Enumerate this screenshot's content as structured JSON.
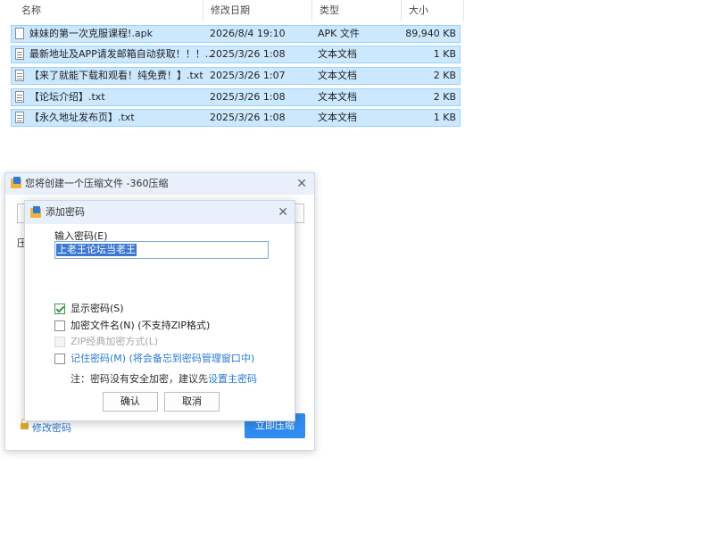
{
  "explorer": {
    "columns": {
      "name": "名称",
      "date": "修改日期",
      "type": "类型",
      "size": "大小"
    },
    "files": [
      {
        "name": "妹妹的第一次克服课程!.apk",
        "date": "2026/8/4 19:10",
        "type": "APK 文件",
        "size": "89,940 KB",
        "icon": "file-icon"
      },
      {
        "name": "最新地址及APP请发邮箱自动获取！！！....",
        "date": "2025/3/26 1:08",
        "type": "文本文档",
        "size": "1 KB",
        "icon": "text-file-icon"
      },
      {
        "name": "【来了就能下载和观看！纯免费！】.txt",
        "date": "2025/3/26 1:07",
        "type": "文本文档",
        "size": "2 KB",
        "icon": "text-file-icon"
      },
      {
        "name": "【论坛介绍】.txt",
        "date": "2025/3/26 1:08",
        "type": "文本文档",
        "size": "2 KB",
        "icon": "text-file-icon"
      },
      {
        "name": "【永久地址发布页】.txt",
        "date": "2025/3/26 1:08",
        "type": "文本文档",
        "size": "1 KB",
        "icon": "text-file-icon"
      }
    ]
  },
  "main_window": {
    "title": "您将创建一个压缩文件 -360压缩",
    "behind_label": "压",
    "modify_password": "修改密码",
    "start_button": "立即压缩"
  },
  "dialog": {
    "title": "添加密码",
    "password_label": "输入密码(E)",
    "password_value": "上老王论坛当老王",
    "options": {
      "show_password": "显示密码(S)",
      "encrypt_filenames": "加密文件名(N) (不支持ZIP格式)",
      "zip_classic": "ZIP经典加密方式(L)",
      "remember_password": "记住密码(M) (将会备忘到密码管理窗口中)"
    },
    "note_prefix": "注：密码没有安全加密，建议先",
    "note_link": "设置主密码",
    "ok_button": "确认",
    "cancel_button": "取消"
  },
  "colors": {
    "selection": "#cce8ff",
    "accent_blue": "#2f8cf0",
    "check_green": "#3a9a4c"
  }
}
